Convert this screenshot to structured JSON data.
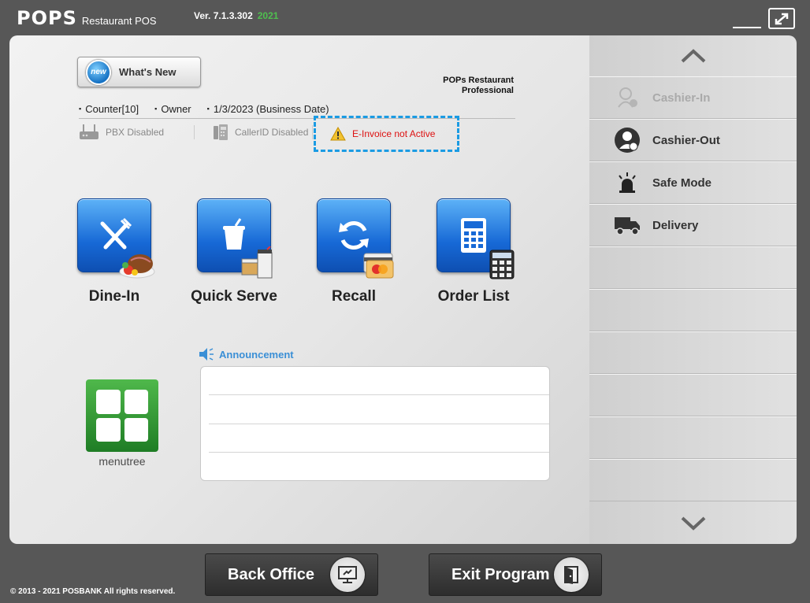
{
  "app": {
    "logo": "POPS",
    "logo_sub": "Restaurant POS",
    "version": "Ver. 7.1.3.302",
    "year": "2021"
  },
  "main": {
    "whats_new": {
      "badge": "new",
      "label": "What's New"
    },
    "product_line1": "POPs Restaurant",
    "product_line2": "Professional",
    "info": {
      "station": "Counter[10]",
      "user": "Owner",
      "business_date": "1/3/2023 (Business Date)"
    },
    "status": {
      "pbx": "PBX Disabled",
      "callerid": "CallerID Disabled",
      "einvoice": "E-Invoice not Active"
    },
    "tiles": [
      {
        "label": "Dine-In",
        "icon": "fork-knife-icon"
      },
      {
        "label": "Quick Serve",
        "icon": "cup-icon"
      },
      {
        "label": "Recall",
        "icon": "refresh-icon"
      },
      {
        "label": "Order List",
        "icon": "calculator-icon"
      }
    ],
    "announcement_label": "Announcement",
    "menutree_label": "menutree"
  },
  "side": {
    "items": [
      {
        "label": "Cashier-In",
        "icon": "cashier-in-icon",
        "enabled": false
      },
      {
        "label": "Cashier-Out",
        "icon": "cashier-out-icon",
        "enabled": true
      },
      {
        "label": "Safe Mode",
        "icon": "alarm-light-icon",
        "enabled": true
      },
      {
        "label": "Delivery",
        "icon": "truck-icon",
        "enabled": true
      }
    ]
  },
  "bottom": {
    "back_office": "Back Office",
    "exit_program": "Exit Program",
    "copyright": "©  2013 - 2021 POSBANK All rights reserved."
  },
  "colors": {
    "accent_blue": "#1a9be3",
    "warning_red": "#dd1111",
    "year_green": "#4fc04f"
  }
}
